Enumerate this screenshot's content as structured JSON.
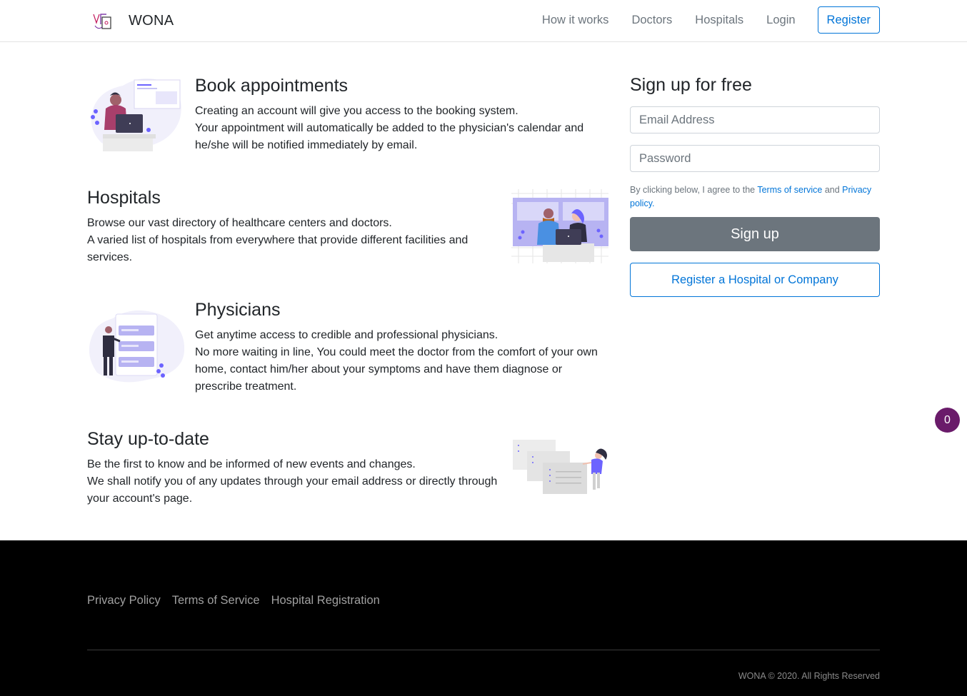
{
  "nav": {
    "brand": "WONA",
    "links": [
      "How it works",
      "Doctors",
      "Hospitals",
      "Login"
    ],
    "register": "Register"
  },
  "features": [
    {
      "title": "Book appointments",
      "lines": [
        "Creating an account will give you access to the booking system.",
        "Your appointment will automatically be added to the physician's calendar and he/she will be notified immediately by email."
      ]
    },
    {
      "title": "Hospitals",
      "lines": [
        "Browse our vast directory of healthcare centers and doctors.",
        "A varied list of hospitals from everywhere that provide different facilities and services."
      ]
    },
    {
      "title": "Physicians",
      "lines": [
        "Get anytime access to credible and professional physicians.",
        "No more waiting in line, You could meet the doctor from the comfort of your own home, contact him/her about your symptoms and have them diagnose or prescribe treatment."
      ]
    },
    {
      "title": "Stay up-to-date",
      "lines": [
        "Be the first to know and be informed of new events and changes.",
        "We shall notify you of any updates through your email address or directly through your account's page."
      ]
    }
  ],
  "signup": {
    "title": "Sign up for free",
    "email_placeholder": "Email Address",
    "password_placeholder": "Password",
    "terms_prefix": "By clicking below, I agree to the ",
    "terms_link": "Terms of service",
    "terms_and": " and ",
    "privacy_link": "Privacy policy",
    "terms_suffix": ".",
    "signup_label": "Sign up",
    "register_company_label": "Register a Hospital or Company"
  },
  "badge_count": "0",
  "footer": {
    "links": [
      "Privacy Policy",
      "Terms of Service",
      "Hospital Registration"
    ],
    "copyright": "WONA © 2020.  All Rights Reserved"
  },
  "colors": {
    "primary": "#0275d8",
    "secondary": "#6c757d",
    "badge": "#6a1b6a",
    "illustration_accent": "#6c63ff"
  }
}
